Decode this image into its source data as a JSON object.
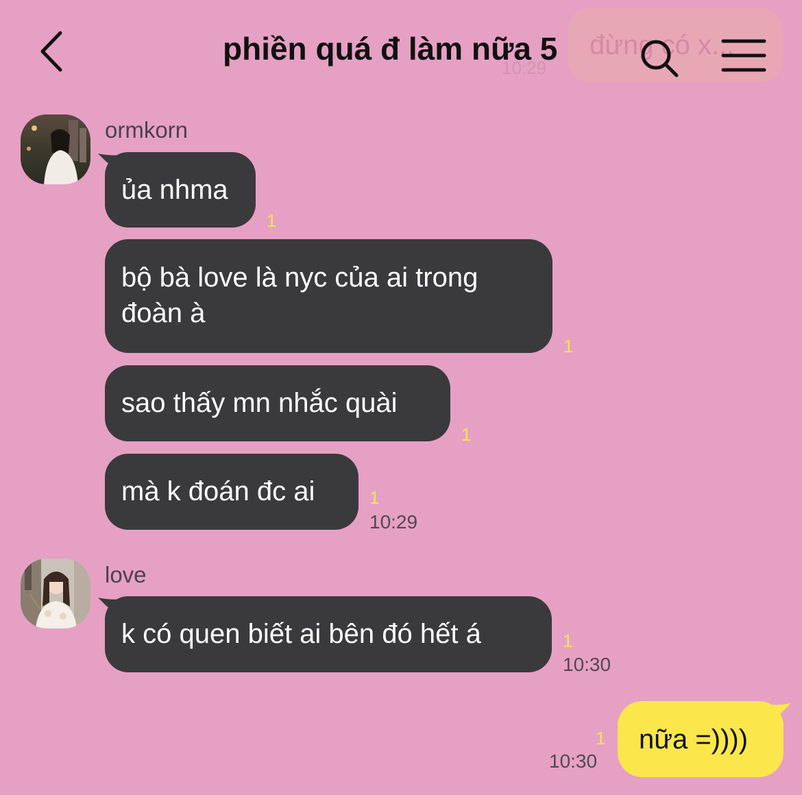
{
  "header": {
    "title": "phiền quá đ làm nữa 5",
    "back_icon": "chevron-left-icon",
    "search_icon": "search-icon",
    "menu_icon": "hamburger-menu-icon",
    "ghost_text": "đừng có x...",
    "ghost_time": "10:29"
  },
  "colors": {
    "background": "#e6a0c4",
    "other_bubble": "#3a3a3c",
    "my_bubble": "#fbe74c",
    "unread": "#f5e64b"
  },
  "messages": {
    "ormkorn": {
      "sender": "ormkorn",
      "m1": {
        "text": "ủa nhma",
        "unread": "1"
      },
      "m2": {
        "line1": "bộ bà love là nyc của ai trong",
        "line2": "đoàn à",
        "unread": "1"
      },
      "m3": {
        "text": "sao thấy mn nhắc quài",
        "unread": "1"
      },
      "m4": {
        "text": "mà k đoán đc ai",
        "unread": "1",
        "time": "10:29"
      }
    },
    "love": {
      "sender": "love",
      "m1": {
        "text": "k có quen biết ai bên đó hết á",
        "unread": "1",
        "time": "10:30"
      }
    },
    "me": {
      "m1": {
        "text": "nữa =))))",
        "unread": "1",
        "time": "10:30"
      }
    }
  }
}
